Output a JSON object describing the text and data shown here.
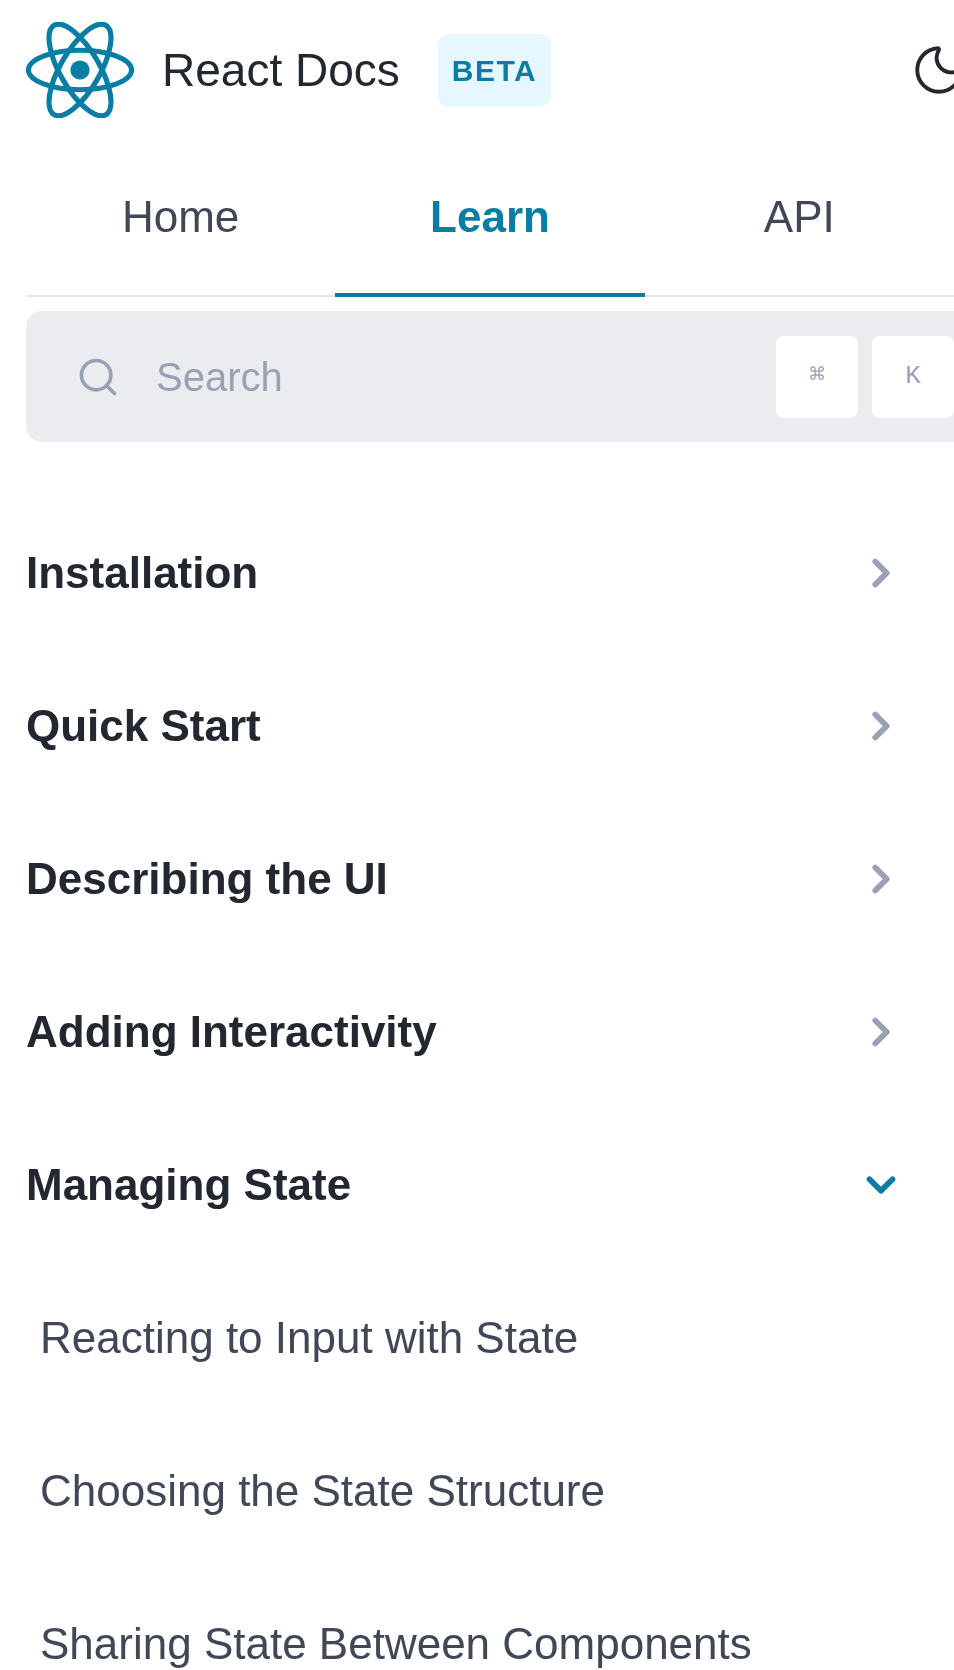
{
  "header": {
    "title": "React Docs",
    "badge": "BETA"
  },
  "tabs": [
    {
      "label": "Home",
      "selected": false
    },
    {
      "label": "Learn",
      "selected": true
    },
    {
      "label": "API",
      "selected": false
    }
  ],
  "search": {
    "placeholder": "Search",
    "keys": [
      "⌘",
      "K"
    ]
  },
  "nav": {
    "items": [
      {
        "label": "Installation",
        "expanded": false
      },
      {
        "label": "Quick Start",
        "expanded": false
      },
      {
        "label": "Describing the UI",
        "expanded": false
      },
      {
        "label": "Adding Interactivity",
        "expanded": false
      },
      {
        "label": "Managing State",
        "expanded": true,
        "children": [
          {
            "label": "Reacting to Input with State"
          },
          {
            "label": "Choosing the State Structure"
          },
          {
            "label": "Sharing State Between Components"
          }
        ]
      }
    ]
  }
}
